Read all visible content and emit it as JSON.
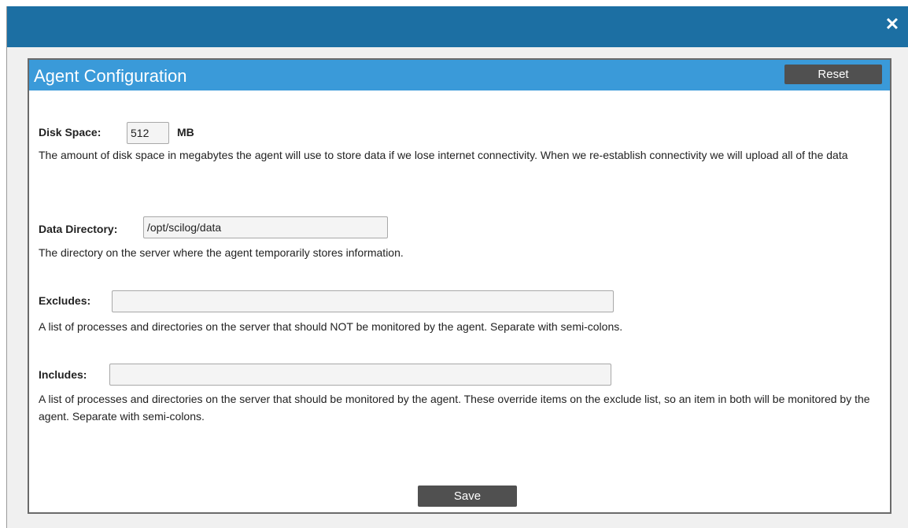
{
  "dialog": {
    "close_glyph": "✕"
  },
  "panel": {
    "title": "Agent Configuration",
    "reset_label": "Reset",
    "save_label": "Save"
  },
  "fields": {
    "disk_space": {
      "label": "Disk Space:",
      "value": "512",
      "unit": "MB",
      "help": "The amount of disk space in megabytes the agent will use to store data if we lose internet connectivity. When we re-establish connectivity we will upload all of the data"
    },
    "data_directory": {
      "label": "Data Directory:",
      "value": "/opt/scilog/data",
      "help": "The directory on the server where the agent temporarily stores information."
    },
    "excludes": {
      "label": "Excludes:",
      "value": "",
      "help": "A list of processes and directories on the server that should NOT be monitored by the agent. Separate with semi-colons."
    },
    "includes": {
      "label": "Includes:",
      "value": "",
      "help": "A list of processes and directories on the server that should be monitored by the agent. These override items on the exclude list, so an item in both will be monitored by the agent. Separate with semi-colons."
    }
  },
  "colors": {
    "titlebar": "#1c6fa3",
    "panel_header": "#3a9ad9",
    "button": "#505050"
  }
}
